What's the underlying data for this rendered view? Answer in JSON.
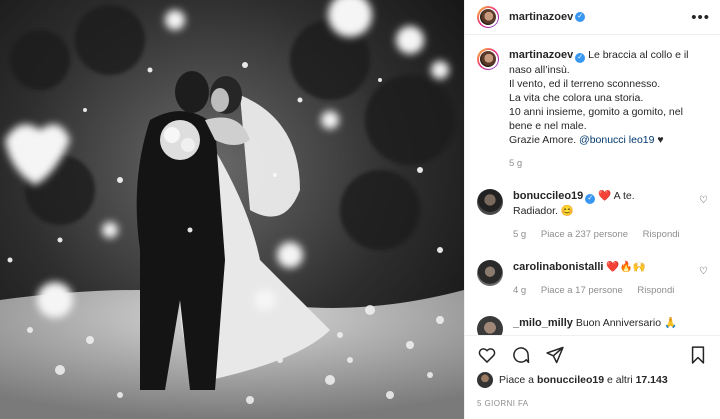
{
  "post": {
    "author": "martinazoev",
    "caption_lines": [
      "Le braccia al collo e il",
      "naso all’insù.",
      "Il vento, ed il terreno sconnesso.",
      "La vita che colora una storia.",
      "10 anni insieme, gomito a gomito, nel",
      "bene e nel male."
    ],
    "caption_last_prefix": "Grazie Amore. ",
    "caption_mention": "@bonucci leo19",
    "caption_heart": "♥",
    "caption_time": "5 g"
  },
  "comments": [
    {
      "user": "bonuccileo19",
      "verified": true,
      "text_before": "❤️ A te.",
      "text_line2": "Radiador. 😊",
      "time": "5 g",
      "likes": "Piace a 237 persone",
      "reply": "Rispondi"
    },
    {
      "user": "carolinabonistalli",
      "verified": false,
      "text_before": "❤️🔥🙌",
      "text_line2": "",
      "time": "4 g",
      "likes": "Piace a 17 persone",
      "reply": "Rispondi"
    },
    {
      "user": "_milo_milly",
      "text_before": "Buon Anniversario 🙏"
    }
  ],
  "footer": {
    "likes_prefix": "Piace a ",
    "likes_user": "bonuccileo19",
    "likes_suffix": " e altri ",
    "likes_count": "17.143",
    "ago": "5 GIORNI FA"
  },
  "icons": [
    "heart-icon",
    "comment-icon",
    "share-icon",
    "bookmark-icon",
    "more-options-icon",
    "verified-icon"
  ],
  "colors": {
    "verified": "#3897f0",
    "mention": "#00376b",
    "muted": "#8e8e8e"
  }
}
